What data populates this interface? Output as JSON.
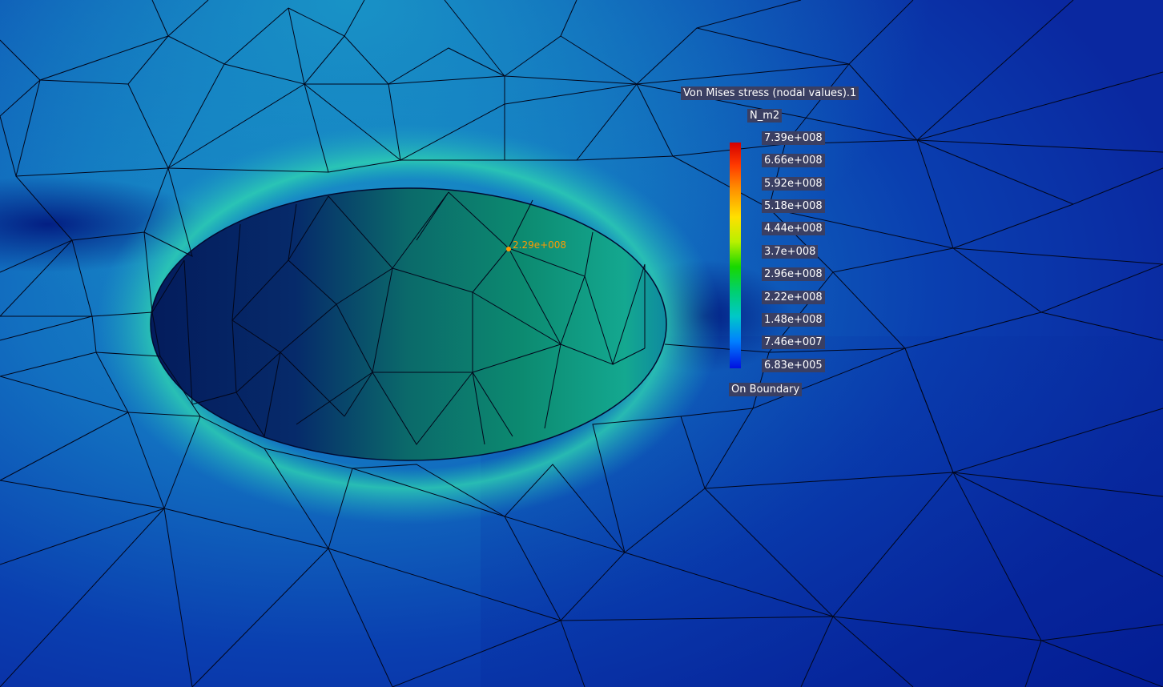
{
  "legend": {
    "title": "Von Mises stress (nodal values).1",
    "unit": "N_m2",
    "ticks": [
      "7.39e+008",
      "6.66e+008",
      "5.92e+008",
      "5.18e+008",
      "4.44e+008",
      "3.7e+008",
      "2.96e+008",
      "2.22e+008",
      "1.48e+008",
      "7.46e+007",
      "6.83e+005"
    ],
    "boundary_label": "On Boundary",
    "colors": [
      "#d40000",
      "#ff8c00",
      "#ffe000",
      "#18d800",
      "#00c8c8",
      "#0080ff",
      "#0010e0"
    ]
  },
  "probe": {
    "value": "2.29e+008",
    "color": "#ff9a00"
  }
}
